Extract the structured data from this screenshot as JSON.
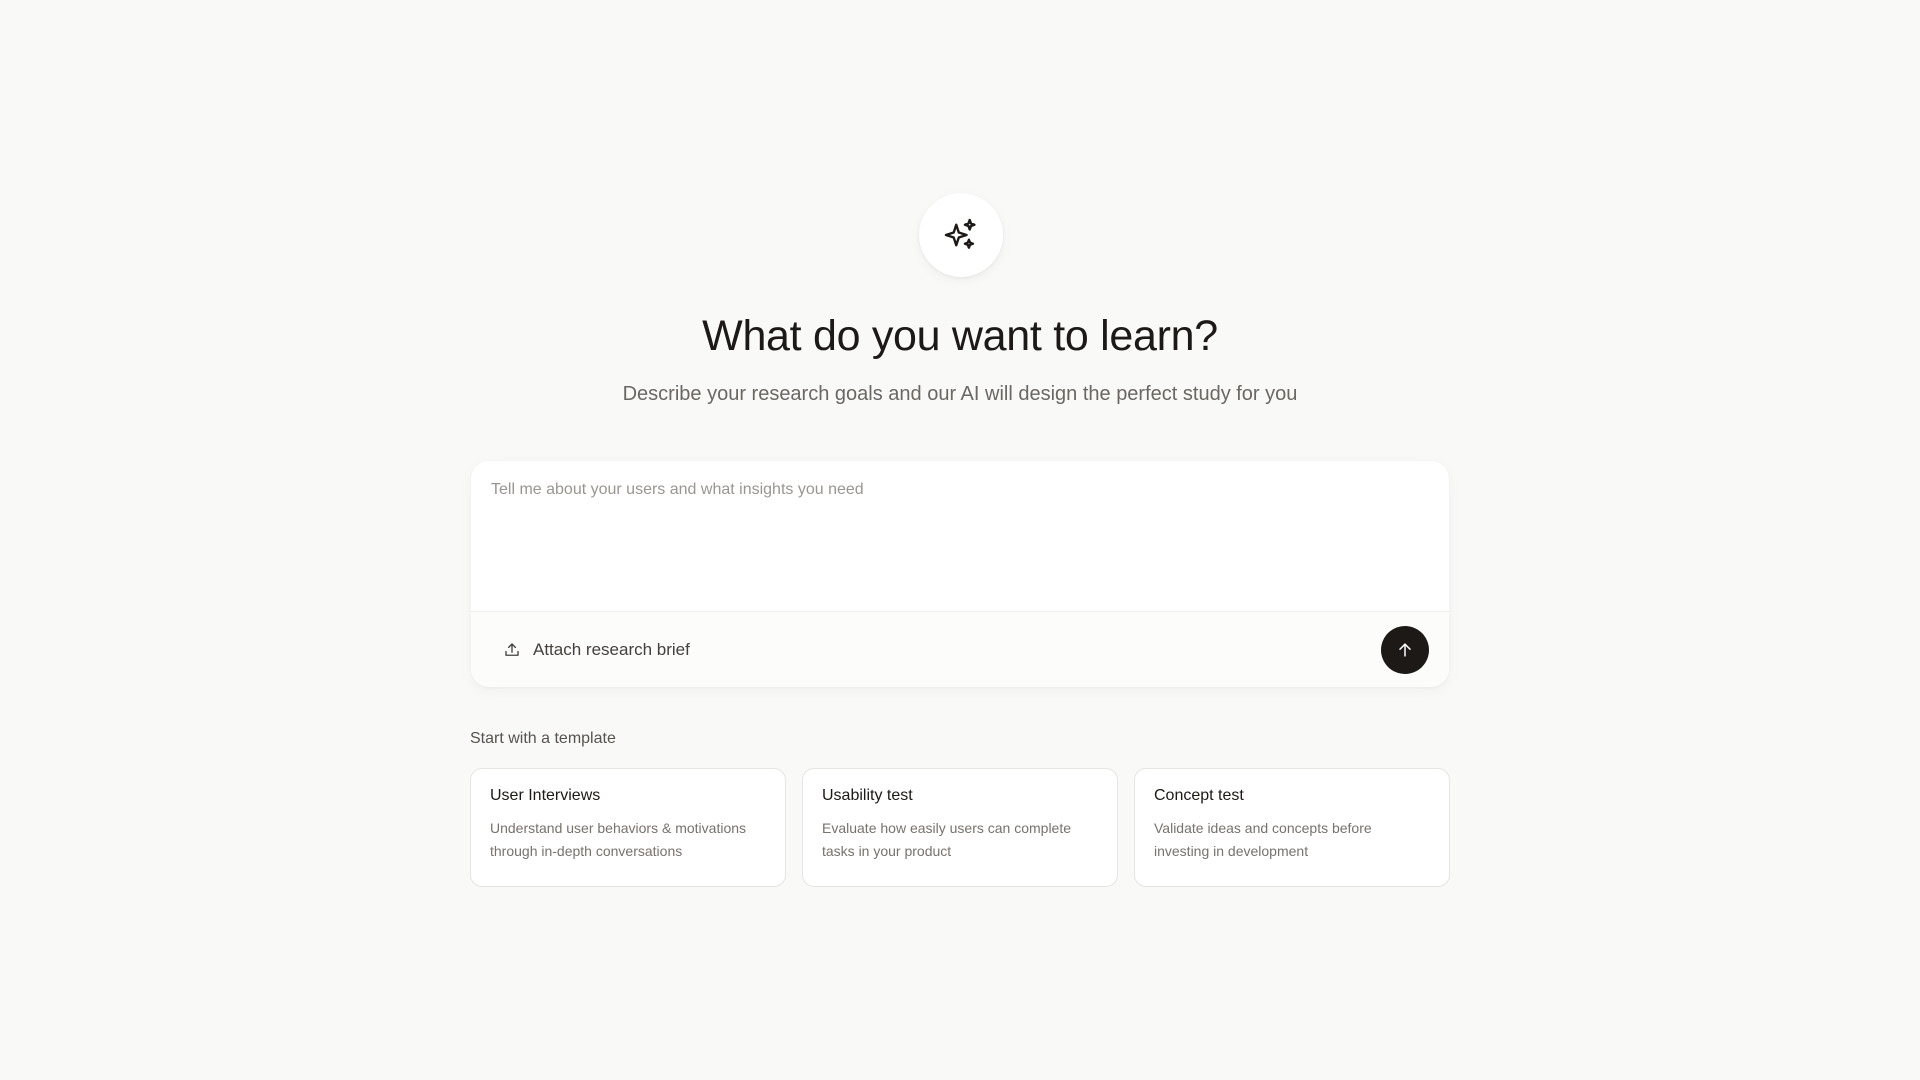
{
  "hero": {
    "icon": "sparkles-icon",
    "title": "What do you want to learn?",
    "subtitle": "Describe your research goals and our AI will design the perfect study for you"
  },
  "composer": {
    "placeholder": "Tell me about your users and what insights you need",
    "value": "",
    "attach_label": "Attach research brief",
    "attach_icon": "upload-icon",
    "send_icon": "arrow-up-icon"
  },
  "templates": {
    "heading": "Start with a template",
    "items": [
      {
        "title": "User Interviews",
        "description": "Understand user behaviors & motivations through in-depth conversations"
      },
      {
        "title": "Usability test",
        "description": "Evaluate how easily users can complete tasks in your product"
      },
      {
        "title": "Concept test",
        "description": "Validate ideas and concepts before investing in development"
      }
    ]
  },
  "colors": {
    "background": "#f9f9f8",
    "accent": "#1c1917",
    "muted_text": "#6b6763"
  }
}
